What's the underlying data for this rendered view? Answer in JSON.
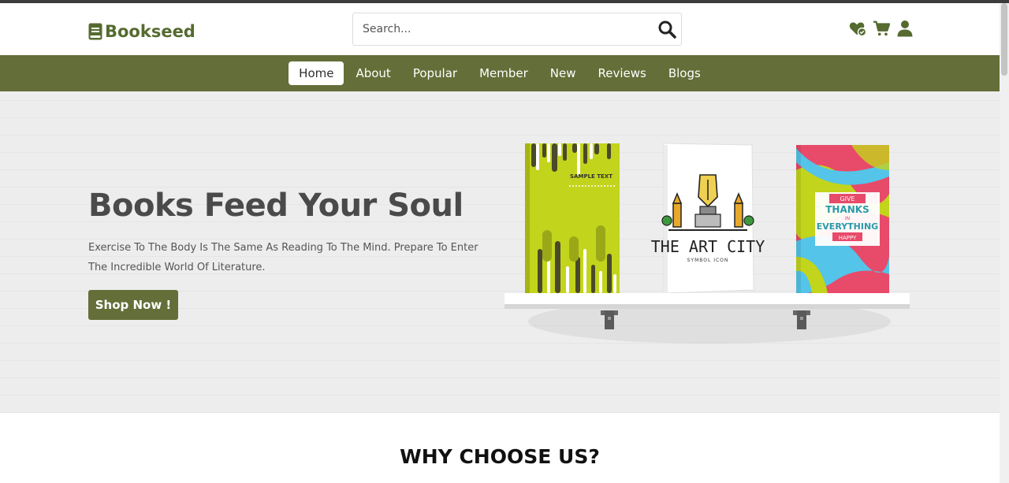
{
  "brand": {
    "name": "Bookseed",
    "accent": "#646e38"
  },
  "search": {
    "placeholder": "Search..."
  },
  "header_icons": [
    "heart-check-icon",
    "cart-icon",
    "user-icon"
  ],
  "nav": {
    "items": [
      {
        "label": "Home",
        "active": true
      },
      {
        "label": "About",
        "active": false
      },
      {
        "label": "Popular",
        "active": false
      },
      {
        "label": "Member",
        "active": false
      },
      {
        "label": "New",
        "active": false
      },
      {
        "label": "Reviews",
        "active": false
      },
      {
        "label": "Blogs",
        "active": false
      }
    ]
  },
  "hero": {
    "title": "Books Feed Your Soul",
    "description": "Exercise To The Body Is The Same As Reading To The Mind. Prepare To Enter The Incredible World Of Literature.",
    "cta_label": "Shop Now !",
    "books": [
      {
        "name": "green-book",
        "text": "SAMPLE TEXT"
      },
      {
        "name": "art-city-book",
        "title": "THE ART CITY",
        "subtitle": "SYMBOL ICON"
      },
      {
        "name": "thanks-book",
        "line1": "GIVE",
        "line2": "THANKS",
        "line3": "IN",
        "line4": "EVERYTHING",
        "line5": "HAPPY"
      }
    ]
  },
  "section": {
    "title": "WHY CHOOSE US?"
  }
}
